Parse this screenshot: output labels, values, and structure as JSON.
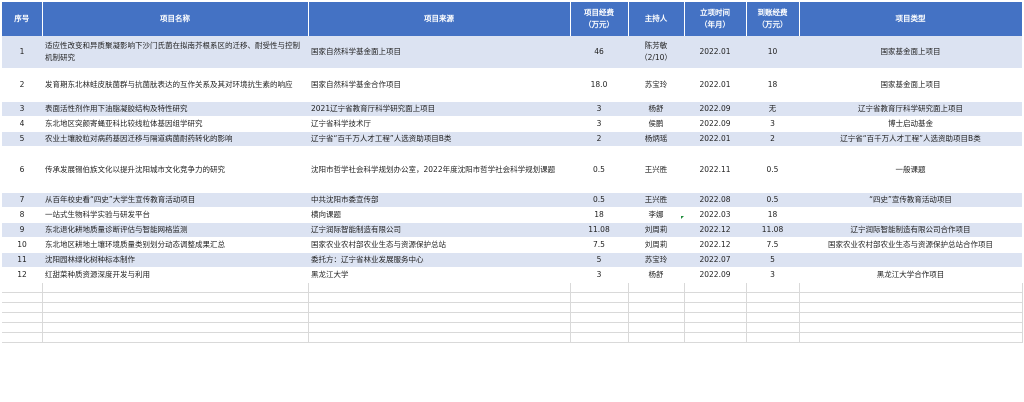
{
  "headers": [
    [
      "序号"
    ],
    [
      "项目名称"
    ],
    [
      "项目来源"
    ],
    [
      "项目经费",
      "（万元）"
    ],
    [
      "主持人"
    ],
    [
      "立项时间",
      "（年月）"
    ],
    [
      "到账经费",
      "（万元）"
    ],
    [
      "项目类型"
    ]
  ],
  "rows": [
    {
      "no": "1",
      "name": "适应性改变和异质聚凝影响下沙门氏菌在拟南芥根系区的迁移、耐受性与控制机制研究",
      "source": "国家自然科学基金面上项目",
      "funding": "46",
      "host": [
        "陈芳敏",
        "（2/10）"
      ],
      "date": "2022.01",
      "received": "10",
      "type": "国家基金面上项目"
    },
    {
      "no": "2",
      "name": "发育期东北林蛙皮肤菌群与抗菌肽表达的互作关系及其对环境抗生素的响应",
      "source": "国家自然科学基金合作项目",
      "funding": "18.0",
      "host": [
        "苏宝玲"
      ],
      "date": "2022.01",
      "received": "18",
      "type": "国家基金面上项目"
    },
    {
      "no": "3",
      "name": "表面活性剂作用下油脂凝胶结构及特性研究",
      "source": "2021辽宁省教育厅科学研究面上项目",
      "funding": "3",
      "host": [
        "杨舒"
      ],
      "date": "2022.09",
      "received": "无",
      "type": "辽宁省教育厅科学研究面上项目"
    },
    {
      "no": "4",
      "name": "东北地区突颜寄蝇亚科比较线粒体基因组学研究",
      "source": "辽宁省科学技术厅",
      "funding": "3",
      "host": [
        "侯鹏"
      ],
      "date": "2022.09",
      "received": "3",
      "type": "博士启动基金"
    },
    {
      "no": "5",
      "name": "农业土壤胶粒对病药基因迁移与隔道病菌耐药转化的影响",
      "source": "辽宁省“百千万人才工程”人选资助项目B类",
      "funding": "2",
      "host": [
        "杨炳瑶"
      ],
      "date": "2022.01",
      "received": "2",
      "type": "辽宁省“百千万人才工程”人选资助项目B类"
    },
    {
      "no": "6",
      "name": "传承发展锡伯族文化以提升沈阳城市文化竞争力的研究",
      "source": "沈阳市哲学社会科学规划办公室，2022年度沈阳市哲学社会科学规划课题",
      "funding": "0.5",
      "host": [
        "王兴胜"
      ],
      "date": "2022.11",
      "received": "0.5",
      "type": "一般课题"
    },
    {
      "no": "7",
      "name": "从百年校史看“四史”大学生宣传教育活动项目",
      "source": "中共沈阳市委宣传部",
      "funding": "0.5",
      "host": [
        "王兴胜"
      ],
      "date": "2022.08",
      "received": "0.5",
      "type": "“四史”宣传教育活动项目"
    },
    {
      "no": "8",
      "name": "一站式生物科学实验与研发平台",
      "source": "横向课题",
      "funding": "18",
      "host": [
        "李娜"
      ],
      "date": "2022.03",
      "received": "18",
      "type": ""
    },
    {
      "no": "9",
      "name": "东北退化耕地质量诊断评估与智能网格监测",
      "source": "辽宁润际智能制造有限公司",
      "funding": "11.08",
      "host": [
        "刘周莉"
      ],
      "date": "2022.12",
      "received": "11.08",
      "type": "辽宁润际智能制造有限公司合作项目"
    },
    {
      "no": "10",
      "name": "东北地区耕地土壤环境质量类别划分动态调整成果汇总",
      "source": "国家农业农村部农业生态与资源保护总站",
      "funding": "7.5",
      "host": [
        "刘周莉"
      ],
      "date": "2022.12",
      "received": "7.5",
      "type": "国家农业农村部农业生态与资源保护总站合作项目"
    },
    {
      "no": "11",
      "name": "沈阳园林绿化树种标本制作",
      "source": "委托方：辽宁省林业发展服务中心",
      "funding": "5",
      "host": [
        "苏宝玲"
      ],
      "date": "2022.07",
      "received": "5",
      "type": ""
    },
    {
      "no": "12",
      "name": "红甜菜种质资源深度开发与利用",
      "source": "黑龙江大学",
      "funding": "3",
      "host": [
        "杨舒"
      ],
      "date": "2022.09",
      "received": "3",
      "type": "黑龙江大学合作项目"
    }
  ],
  "empty_rows": 6,
  "colors": {
    "header_bg": "#4472c4",
    "band": "#dce3f2",
    "marker": "#1e8c3a"
  }
}
